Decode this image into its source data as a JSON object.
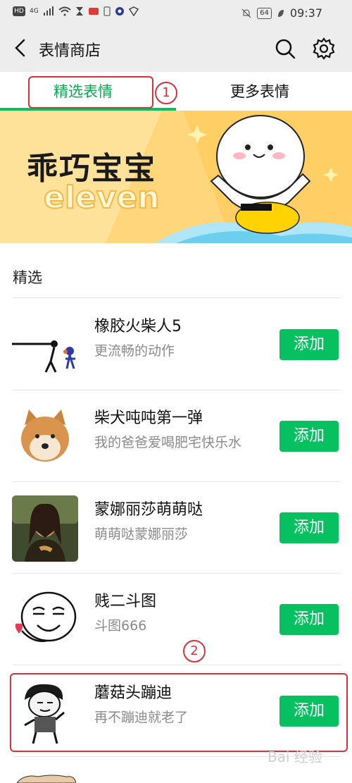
{
  "status_bar": {
    "left_icons": [
      "HD",
      "4G"
    ],
    "battery": "64",
    "time": "09:37"
  },
  "nav": {
    "title": "表情商店",
    "icons": [
      "back-arrow-icon",
      "search-icon",
      "gear-icon"
    ]
  },
  "tabs": [
    {
      "label": "精选表情",
      "selected": true
    },
    {
      "label": "更多表情",
      "selected": false
    }
  ],
  "banner": {
    "title": "乖巧宝宝",
    "subtitle": "eleven"
  },
  "section": {
    "label": "精选"
  },
  "items": [
    {
      "title": "橡胶火柴人5",
      "subtitle": "更流畅的动作",
      "button": "添加"
    },
    {
      "title": "柴犬吨吨第一弹",
      "subtitle": "我的爸爸爱喝肥宅快乐水",
      "button": "添加"
    },
    {
      "title": "蒙娜丽莎萌萌哒",
      "subtitle": "萌萌哒蒙娜丽莎",
      "button": "添加"
    },
    {
      "title": "贱二斗图",
      "subtitle": "斗图666",
      "button": "添加"
    },
    {
      "title": "蘑菇头蹦迪",
      "subtitle": "再不蹦迪就老了",
      "button": "添加"
    }
  ],
  "annotations": {
    "one": "1",
    "two": "2"
  },
  "watermark": "Bai 经验",
  "colors": {
    "accent": "#07c160",
    "annotation": "#d9303a",
    "nav_bg": "#ededed"
  }
}
